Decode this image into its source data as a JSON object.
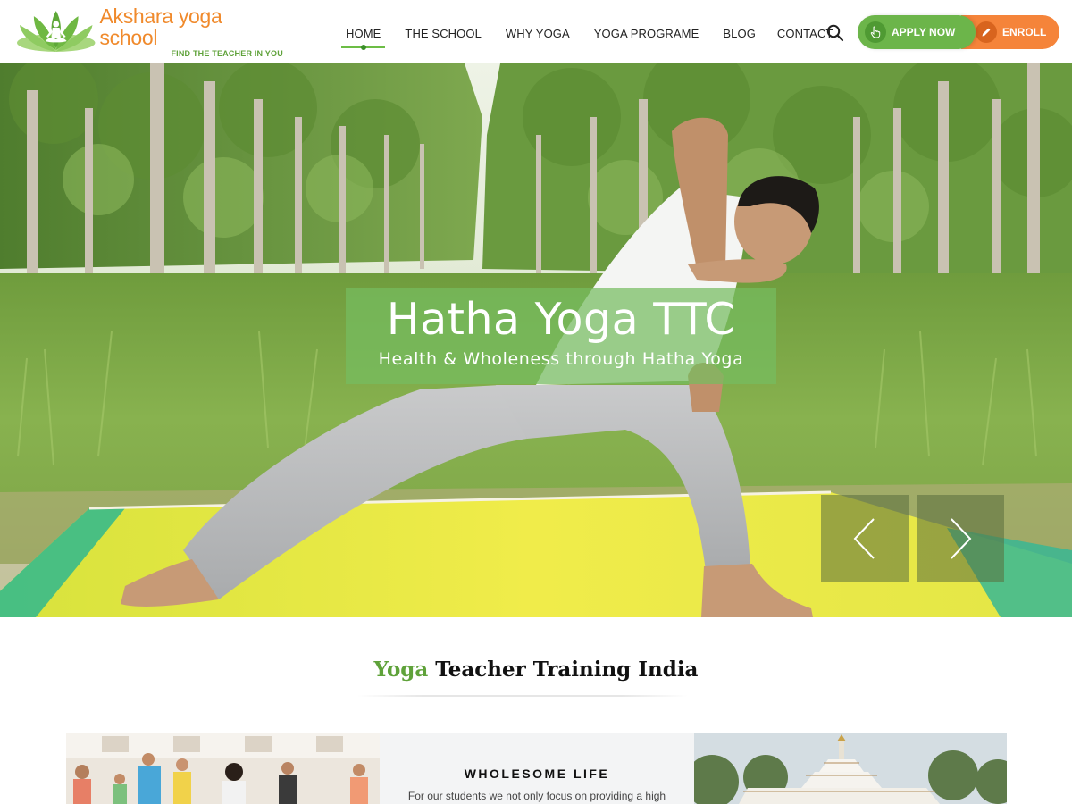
{
  "brand": {
    "name": "Akshara yoga school",
    "tagline": "FIND THE TEACHER IN YOU",
    "logo_icon": "lotus-meditation-icon",
    "colors": {
      "orange": "#f08a2c",
      "green": "#5fa23a"
    }
  },
  "nav": {
    "items": [
      {
        "label": "HOME",
        "active": true
      },
      {
        "label": "THE SCHOOL",
        "active": false
      },
      {
        "label": "WHY YOGA",
        "active": false
      },
      {
        "label": "YOGA PROGRAME",
        "active": false
      },
      {
        "label": "BLOG",
        "active": false
      },
      {
        "label": "CONTACT",
        "active": false
      }
    ],
    "search_icon": "search-icon"
  },
  "cta": {
    "apply_label": "APPLY NOW",
    "apply_icon": "hand-pointer-icon",
    "apply_color": "#6cb54a",
    "enroll_label": "ENROLL",
    "enroll_icon": "pencil-icon",
    "enroll_color": "#f5843a"
  },
  "hero": {
    "title": "Hatha Yoga TTC",
    "subtitle": "Health & Wholeness through Hatha Yoga",
    "prev_icon": "chevron-left-icon",
    "next_icon": "chevron-right-icon"
  },
  "section": {
    "title_accent": "Yoga",
    "title_rest": " Teacher Training India"
  },
  "cards": {
    "middle_title": "WHOLESOME LIFE",
    "middle_text": "For our students we not only focus on providing a high"
  }
}
